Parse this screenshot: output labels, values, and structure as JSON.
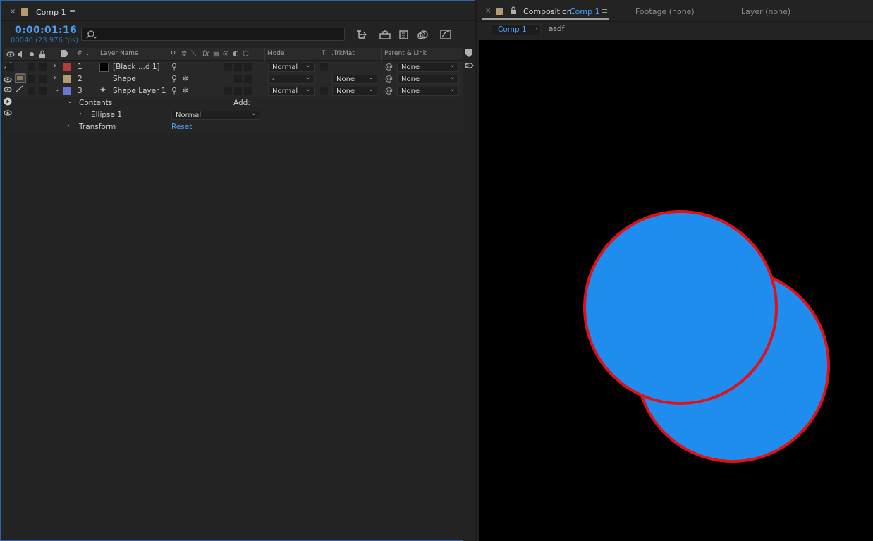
{
  "timeline": {
    "tab_title": "Comp 1",
    "close_glyph": "×",
    "menu_glyph": "≡",
    "timecode": "0:00:01:16",
    "frame_info": "00040 (23.976 fps)",
    "search_placeholder": "",
    "columns": {
      "num": "#",
      "layer_name": "Layer Name",
      "mode": "Mode",
      "t": "T",
      "trkmat": ".TrkMat",
      "parent": "Parent & Link"
    },
    "layers": [
      {
        "num": "1",
        "name": "[Black ...d 1]",
        "label_color": "#b53b3b",
        "mode": "Normal",
        "trkmat": "",
        "parent": "None",
        "visible": false
      },
      {
        "num": "2",
        "name": "Shape",
        "label_color": "#b59a6e",
        "mode": "-",
        "trkmat": "None",
        "parent": "None",
        "visible": true
      },
      {
        "num": "3",
        "name": "Shape Layer 1",
        "label_color": "#6b76d6",
        "mode": "Normal",
        "trkmat": "None",
        "parent": "None",
        "visible": true
      }
    ],
    "contents_label": "Contents",
    "add_label": "Add:",
    "ellipse_label": "Ellipse 1",
    "ellipse_mode": "Normal",
    "transform_label": "Transform",
    "reset_label": "Reset"
  },
  "composition": {
    "tab_prefix": "Composition",
    "tab_comp": "Comp 1",
    "footage_tab": "Footage (none)",
    "layer_tab": "Layer (none)",
    "crumb_active": "Comp 1",
    "crumb_next": "asdf",
    "circle_fill": "#1f8ded",
    "circle_stroke": "#e1101a"
  }
}
